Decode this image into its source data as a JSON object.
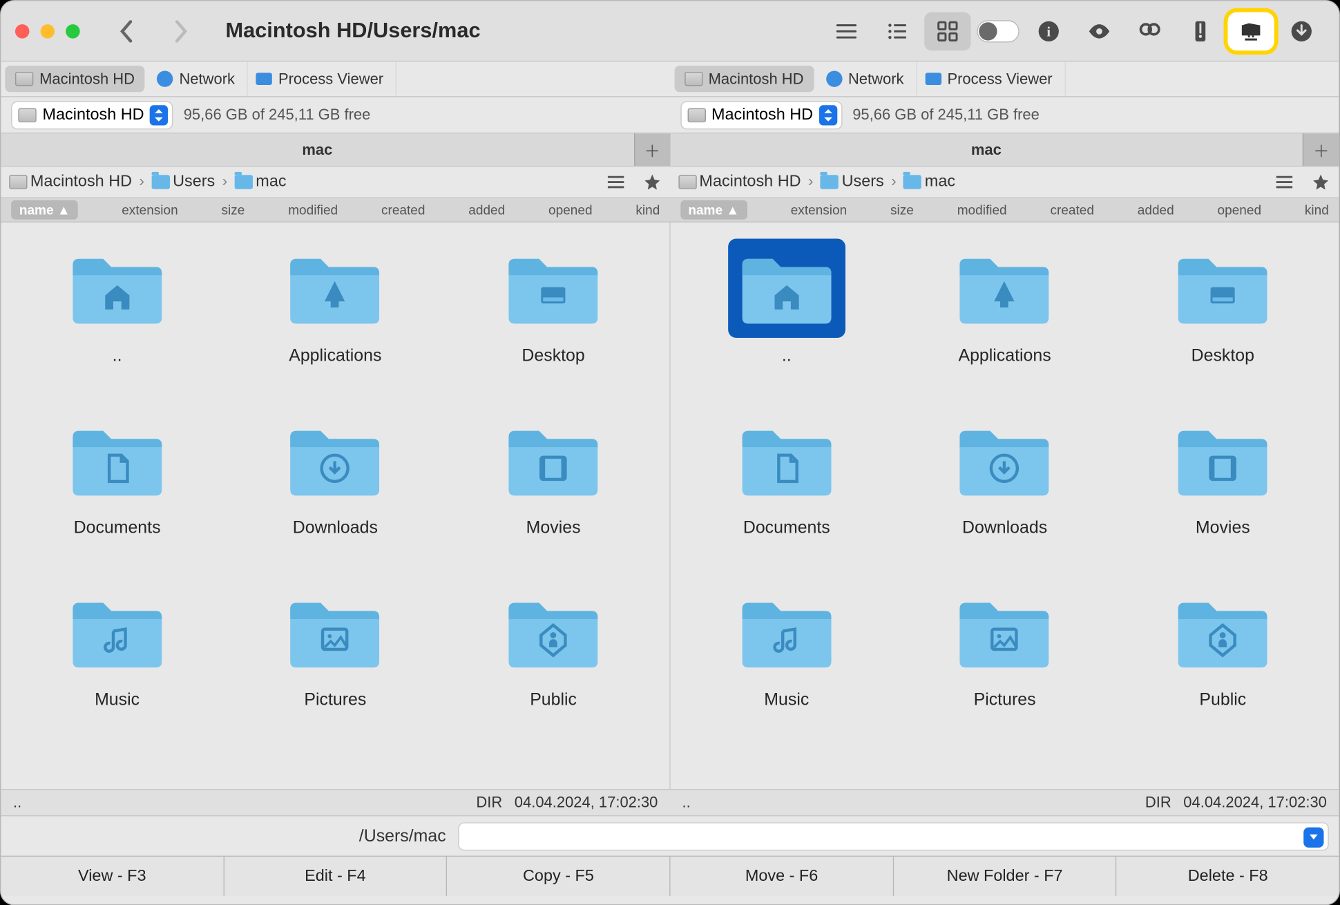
{
  "window": {
    "title": "Macintosh HD/Users/mac"
  },
  "toolbar": {
    "back": "‹",
    "forward": "›"
  },
  "location_tabs": {
    "left": [
      {
        "label": "Macintosh HD",
        "icon": "disk"
      },
      {
        "label": "Network",
        "icon": "globe"
      },
      {
        "label": "Process Viewer",
        "icon": "monitor"
      }
    ],
    "right": [
      {
        "label": "Macintosh HD",
        "icon": "disk"
      },
      {
        "label": "Network",
        "icon": "globe"
      },
      {
        "label": "Process Viewer",
        "icon": "monitor"
      }
    ]
  },
  "drive_bar": {
    "left": {
      "drive": "Macintosh HD",
      "free": "95,66 GB of 245,11 GB free"
    },
    "right": {
      "drive": "Macintosh HD",
      "free": "95,66 GB of 245,11 GB free"
    }
  },
  "tabs": {
    "left": {
      "label": "mac"
    },
    "right": {
      "label": "mac"
    }
  },
  "breadcrumb": {
    "left": [
      "Macintosh HD",
      "Users",
      "mac"
    ],
    "right": [
      "Macintosh HD",
      "Users",
      "mac"
    ]
  },
  "sort_cols": [
    "name",
    "extension",
    "size",
    "modified",
    "created",
    "added",
    "opened",
    "kind"
  ],
  "folders": {
    "left": [
      {
        "name": "..",
        "icon": "home"
      },
      {
        "name": "Applications",
        "icon": "apps"
      },
      {
        "name": "Desktop",
        "icon": "desktop"
      },
      {
        "name": "Documents",
        "icon": "doc"
      },
      {
        "name": "Downloads",
        "icon": "download"
      },
      {
        "name": "Movies",
        "icon": "movie"
      },
      {
        "name": "Music",
        "icon": "music"
      },
      {
        "name": "Pictures",
        "icon": "picture"
      },
      {
        "name": "Public",
        "icon": "public"
      }
    ],
    "right": [
      {
        "name": "..",
        "icon": "home",
        "selected": true
      },
      {
        "name": "Applications",
        "icon": "apps"
      },
      {
        "name": "Desktop",
        "icon": "desktop"
      },
      {
        "name": "Documents",
        "icon": "doc"
      },
      {
        "name": "Downloads",
        "icon": "download"
      },
      {
        "name": "Movies",
        "icon": "movie"
      },
      {
        "name": "Music",
        "icon": "music"
      },
      {
        "name": "Pictures",
        "icon": "picture"
      },
      {
        "name": "Public",
        "icon": "public"
      }
    ]
  },
  "status": {
    "left": {
      "path": "..",
      "type": "DIR",
      "date": "04.04.2024, 17:02:30"
    },
    "right": {
      "path": "..",
      "type": "DIR",
      "date": "04.04.2024, 17:02:30"
    }
  },
  "cmd": {
    "path": "/Users/mac"
  },
  "fn": [
    "View - F3",
    "Edit - F4",
    "Copy - F5",
    "Move - F6",
    "New Folder - F7",
    "Delete - F8"
  ]
}
